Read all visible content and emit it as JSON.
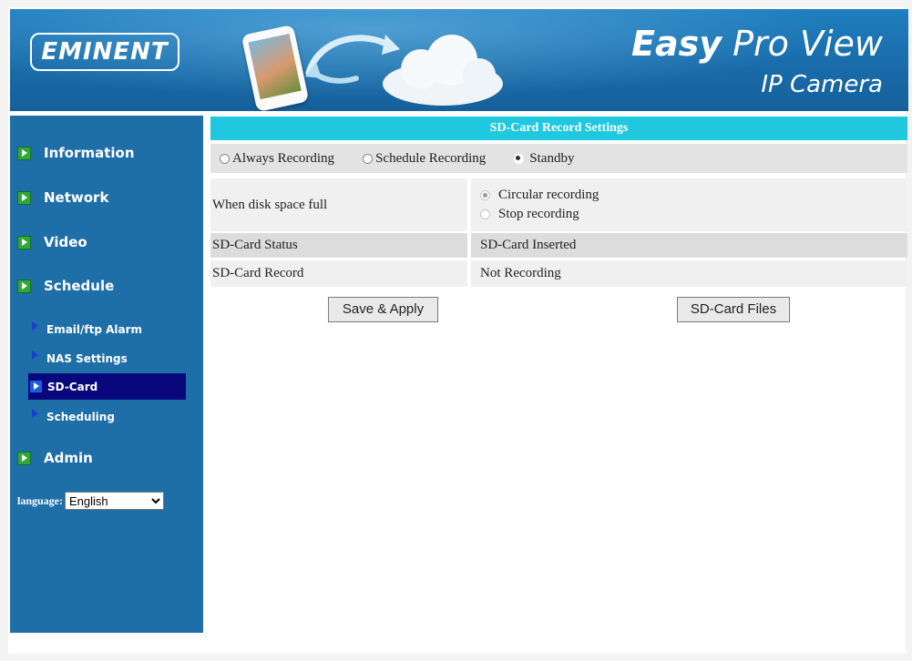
{
  "header": {
    "logo_text": "EMINENT",
    "brand_title_bold": "Easy",
    "brand_title_rest": " Pro View",
    "brand_subtitle": "IP Camera"
  },
  "sidebar": {
    "items": [
      {
        "label": "Information",
        "icon": "arrow-right-icon"
      },
      {
        "label": "Network",
        "icon": "arrow-right-icon"
      },
      {
        "label": "Video",
        "icon": "arrow-right-icon"
      },
      {
        "label": "Schedule",
        "icon": "arrow-right-icon"
      },
      {
        "label": "Admin",
        "icon": "arrow-right-icon"
      }
    ],
    "sub_items": [
      {
        "label": "Email/ftp Alarm"
      },
      {
        "label": "NAS Settings"
      },
      {
        "label": "SD-Card",
        "active": true
      },
      {
        "label": "Scheduling"
      }
    ],
    "language_label": "language:",
    "language_value": "English"
  },
  "main": {
    "title": "SD-Card Record Settings",
    "modes": [
      {
        "label": "Always Recording",
        "selected": false
      },
      {
        "label": "Schedule Recording",
        "selected": false
      },
      {
        "label": "Standby",
        "selected": true
      }
    ],
    "disk_full": {
      "label": "When disk space full",
      "options": [
        {
          "label": "Circular recording",
          "selected": true
        },
        {
          "label": "Stop recording",
          "selected": false
        }
      ]
    },
    "status": {
      "label": "SD-Card Status",
      "value": "SD-Card Inserted"
    },
    "record": {
      "label": "SD-Card Record",
      "value": "Not Recording"
    },
    "buttons": {
      "save": "Save & Apply",
      "files": "SD-Card Files"
    }
  },
  "colors": {
    "sidebar_bg": "#1e6ea7",
    "panel_title_bg": "#1fc8de",
    "active_item_bg": "#08087c"
  }
}
